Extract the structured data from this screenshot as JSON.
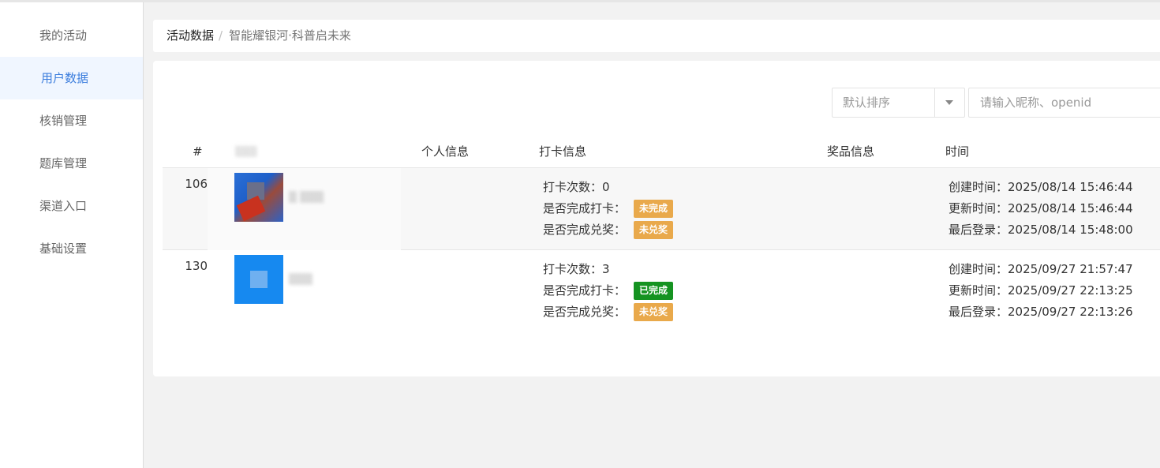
{
  "sidebar": {
    "items": [
      {
        "label": "我的活动",
        "active": false
      },
      {
        "label": "用户数据",
        "active": true
      },
      {
        "label": "核销管理",
        "active": false
      },
      {
        "label": "题库管理",
        "active": false
      },
      {
        "label": "渠道入口",
        "active": false
      },
      {
        "label": "基础设置",
        "active": false
      }
    ]
  },
  "breadcrumb": {
    "root": "活动数据",
    "separator": "/",
    "current": "智能耀银河·科普启未来"
  },
  "toolbar": {
    "sort_value": "默认排序",
    "search_placeholder": "请输入昵称、openid"
  },
  "table": {
    "headers": {
      "index": "#",
      "personal": "个人信息",
      "checkin": "打卡信息",
      "prize": "奖品信息",
      "time": "时间"
    },
    "labels": {
      "checkin_count": "打卡次数：",
      "checkin_done": "是否完成打卡：",
      "prize_done": "是否完成兑奖：",
      "created": "创建时间：",
      "updated": "更新时间：",
      "last_login": "最后登录："
    },
    "rows": [
      {
        "id": "106",
        "checkin_count": "0",
        "checkin_status": "未完成",
        "prize_status": "未兑奖",
        "created": "2025/08/14 15:46:44",
        "updated": "2025/08/14 15:46:44",
        "last_login": "2025/08/14 15:48:00"
      },
      {
        "id": "130",
        "checkin_count": "3",
        "checkin_status": "已完成",
        "prize_status": "未兑奖",
        "created": "2025/09/27 21:57:47",
        "updated": "2025/09/27 22:13:25",
        "last_login": "2025/09/27 22:13:26"
      }
    ]
  },
  "colors": {
    "accent": "#3b7ddd",
    "badge_pending": "#e9a94b",
    "badge_done": "#159321"
  }
}
